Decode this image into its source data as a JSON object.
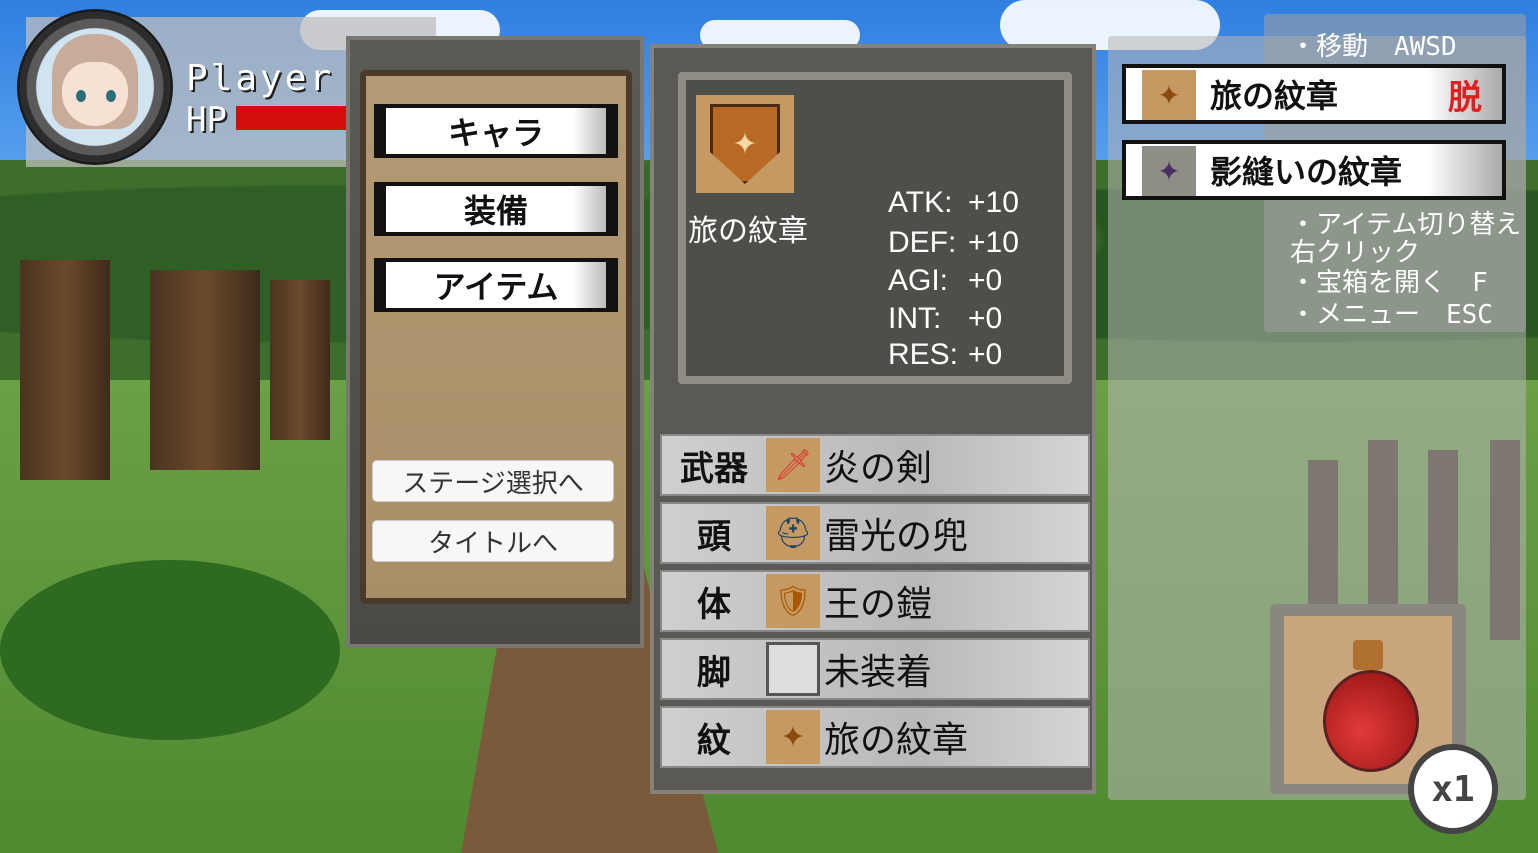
{
  "player": {
    "name": "Player",
    "hp_label": "HP",
    "hp_ratio": 1.0
  },
  "menu": {
    "buttons": [
      "キャラ",
      "装備",
      "アイテム"
    ],
    "stage_select": "ステージ選択へ",
    "to_title": "タイトルへ"
  },
  "detail": {
    "name": "旅の紋章",
    "icon": "emblem-icon",
    "stats": [
      {
        "key": "ATK:",
        "value": "+10"
      },
      {
        "key": "DEF:",
        "value": "+10"
      },
      {
        "key": "AGI:",
        "value": "+0"
      },
      {
        "key": "INT:",
        "value": "+0"
      },
      {
        "key": "RES:",
        "value": "+0"
      }
    ]
  },
  "equipment": [
    {
      "slot": "武器",
      "item": "炎の剣",
      "icon": "fire-sword-icon",
      "glyph": "🗡"
    },
    {
      "slot": "頭",
      "item": "雷光の兜",
      "icon": "helmet-icon",
      "glyph": "⛑"
    },
    {
      "slot": "体",
      "item": "王の鎧",
      "icon": "armor-icon",
      "glyph": "🛡"
    },
    {
      "slot": "脚",
      "item": "未装着",
      "icon": "empty-slot-icon",
      "glyph": ""
    },
    {
      "slot": "紋",
      "item": "旅の紋章",
      "icon": "emblem-icon",
      "glyph": "✦"
    }
  ],
  "help": [
    "・移動　AWSD",
    "・アイテム切り替え",
    "右クリック",
    "・宝箱を開く　F",
    "・メニュー　ESC"
  ],
  "items": [
    {
      "name": "旅の紋章",
      "remove": "脱",
      "icon": "emblem-icon"
    },
    {
      "name": "影縫いの紋章",
      "remove": "",
      "icon": "shadow-emblem-icon"
    }
  ],
  "quick_item": {
    "icon": "potion-icon",
    "count": "x1"
  },
  "colors": {
    "hp": "#d10d0d",
    "remove": "#e02020"
  }
}
